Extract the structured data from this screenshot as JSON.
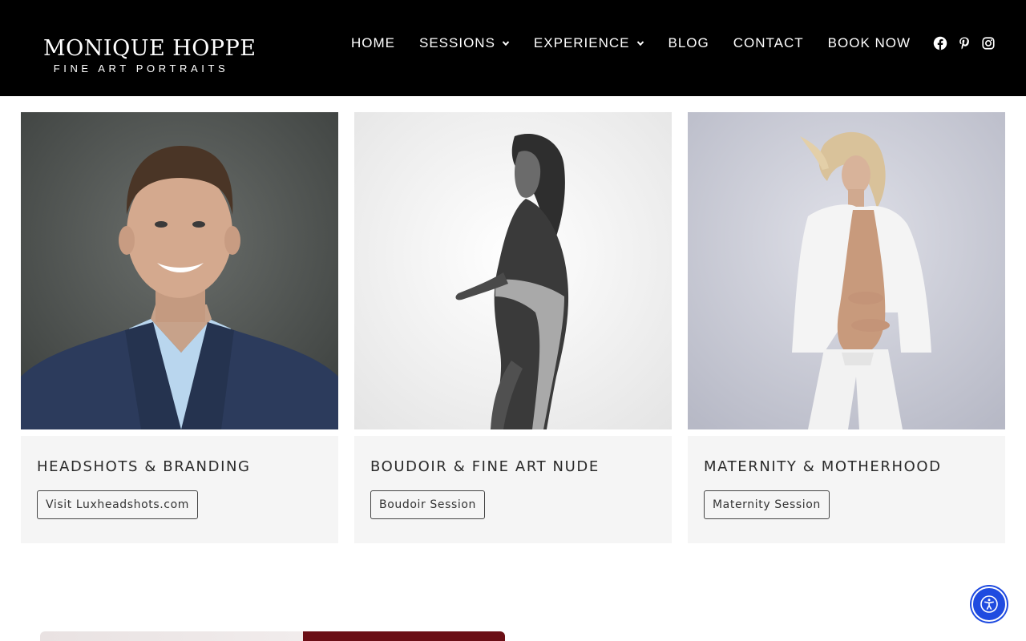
{
  "brand": {
    "name": "MONIQUE HOPPE",
    "tagline": "FINE ART PORTRAITS"
  },
  "nav": {
    "items": [
      {
        "label": "HOME",
        "dropdown": false
      },
      {
        "label": "SESSIONS",
        "dropdown": true
      },
      {
        "label": "EXPERIENCE",
        "dropdown": true
      },
      {
        "label": "BLOG",
        "dropdown": false
      },
      {
        "label": "CONTACT",
        "dropdown": false
      },
      {
        "label": "BOOK NOW",
        "dropdown": false
      }
    ]
  },
  "social": [
    {
      "icon": "facebook-icon"
    },
    {
      "icon": "pinterest-icon"
    },
    {
      "icon": "instagram-icon"
    }
  ],
  "cards": [
    {
      "title": "HEADSHOTS & BRANDING",
      "button": "Visit Luxheadshots.com",
      "photo": "man-headshot-photo"
    },
    {
      "title": "BOUDOIR & FINE ART NUDE",
      "button": "Boudoir Session",
      "photo": "boudoir-bw-photo"
    },
    {
      "title": "MATERNITY & MOTHERHOOD",
      "button": "Maternity Session",
      "photo": "maternity-photo"
    }
  ],
  "colors": {
    "header_bg": "#000000",
    "card_bg": "#f5f5f5",
    "accessibility_blue": "#1f4be0",
    "strip_accent": "#6b0f16"
  },
  "accessibility": {
    "icon": "accessibility-icon"
  }
}
